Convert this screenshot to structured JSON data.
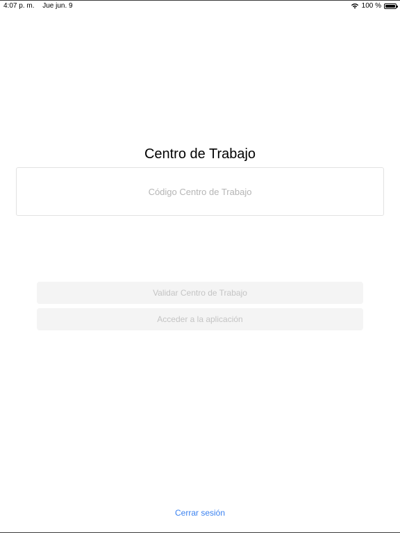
{
  "status_bar": {
    "time": "4:07 p. m.",
    "date": "Jue jun. 9",
    "battery_text": "100 %",
    "battery_level": 1.0
  },
  "main": {
    "title": "Centro de Trabajo",
    "code_input": {
      "placeholder": "Código Centro de Trabajo",
      "value": ""
    },
    "validate_button_label": "Validar Centro de Trabajo",
    "access_button_label": "Acceder a la aplicación"
  },
  "footer": {
    "logout_label": "Cerrar sesión"
  },
  "colors": {
    "link": "#3b82f0",
    "disabled_button_bg": "#f4f4f4",
    "disabled_button_text": "#c4c4c4",
    "input_border": "#e2e2e2"
  },
  "icons": {
    "wifi": "wifi-icon",
    "battery": "battery-icon"
  }
}
